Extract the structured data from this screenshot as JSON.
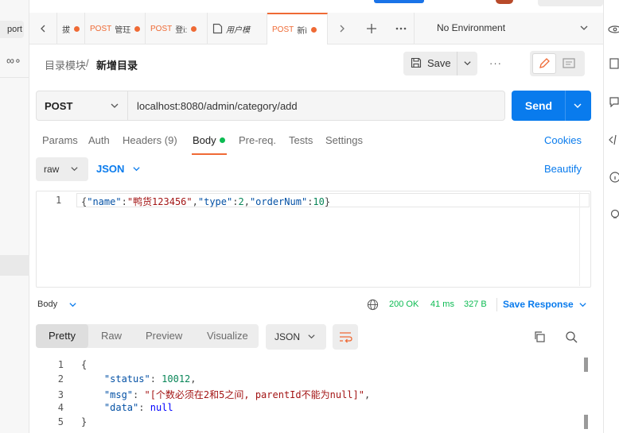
{
  "left_strip": {
    "import_label": "port",
    "more_label": "∞∘"
  },
  "tabs": [
    {
      "method": "",
      "name": "拔",
      "dot": true
    },
    {
      "method": "POST",
      "name": "管玨",
      "dot": true
    },
    {
      "method": "POST",
      "name": "登i:",
      "dot": true
    },
    {
      "method": "",
      "name": "用户模",
      "dot": false
    },
    {
      "method": "POST",
      "name": "新ì",
      "dot": true,
      "active": true
    }
  ],
  "environment": {
    "label": "No Environment"
  },
  "header": {
    "breadcrumb_parent": "目录模块",
    "breadcrumb_sep": "/",
    "breadcrumb_current": "新增目录",
    "save_label": "Save",
    "more_label": "···"
  },
  "request": {
    "method": "POST",
    "url": "localhost:8080/admin/category/add",
    "send_label": "Send"
  },
  "request_tabs": {
    "params": "Params",
    "auth": "Auth",
    "headers": "Headers",
    "headers_count": "(9)",
    "body": "Body",
    "prereq": "Pre-req.",
    "tests": "Tests",
    "settings": "Settings",
    "cookies": "Cookies"
  },
  "body_options": {
    "mode": "raw",
    "type": "JSON",
    "beautify": "Beautify"
  },
  "editor": {
    "line_number": "1",
    "b_open": "{",
    "k_name": "\"name\"",
    "c1": ":",
    "v_name": "\"鸭货123456\"",
    "c2": ",",
    "k_type": "\"type\"",
    "c3": ":",
    "v_type": "2",
    "c4": ",",
    "k_order": "\"orderNum\"",
    "c5": ":",
    "v_order": "10",
    "b_close": "}"
  },
  "response": {
    "body_label": "Body",
    "status": "200 OK",
    "time": "41 ms",
    "size": "327 B",
    "save_response": "Save Response",
    "view_tabs": {
      "pretty": "Pretty",
      "raw": "Raw",
      "preview": "Preview",
      "visualize": "Visualize"
    },
    "format": "JSON",
    "lines": {
      "l1": "1",
      "l2": "2",
      "l3": "3",
      "l4": "4",
      "l5": "5",
      "open": "{",
      "k_status": "\"status\"",
      "v_status": "10012",
      "k_msg": "\"msg\"",
      "v_msg": "\"[个数必须在2和5之间, parentId不能为null]\"",
      "k_data": "\"data\"",
      "v_data": "null",
      "colon": ": ",
      "comma": ",",
      "close": "}"
    }
  },
  "colors": {
    "accent": "#ef6a35",
    "primary": "#097bed",
    "success": "#0cbb52"
  }
}
